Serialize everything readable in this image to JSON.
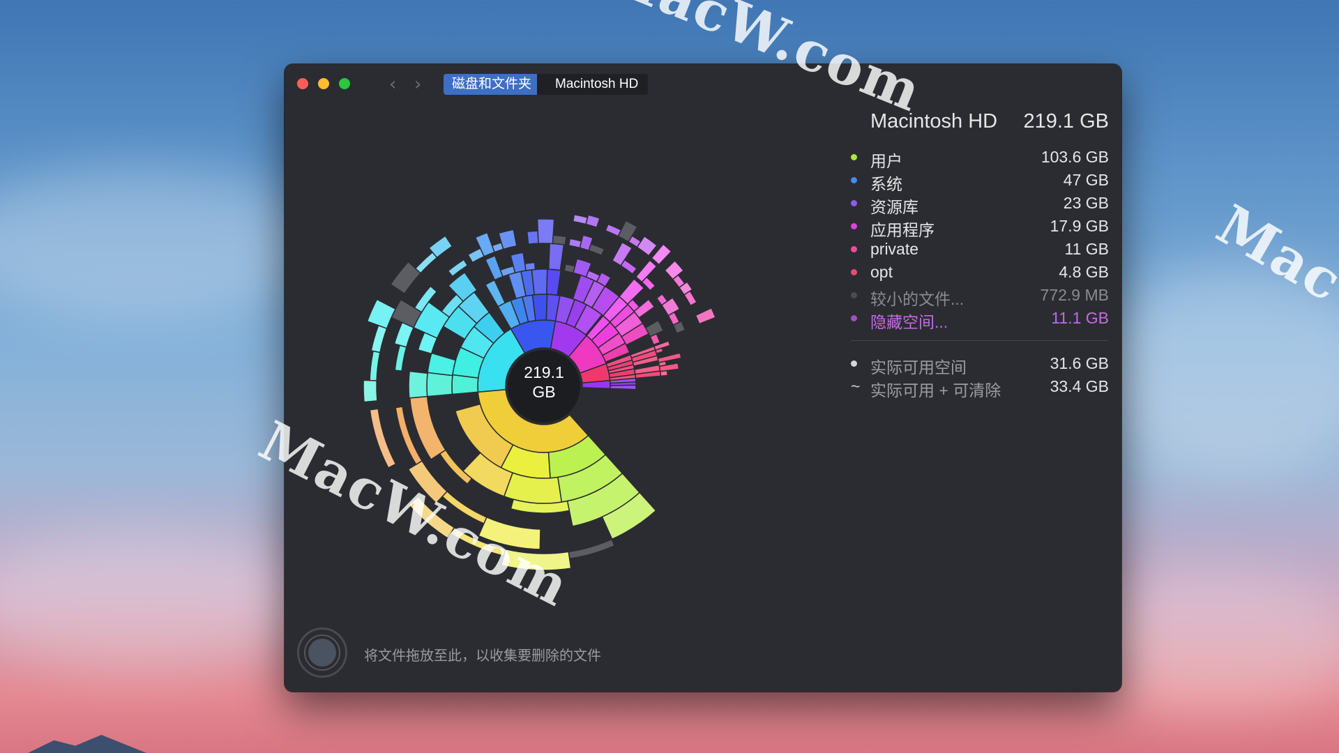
{
  "breadcrumb": {
    "crumb1": "磁盘和文件夹",
    "crumb2": "Macintosh HD"
  },
  "chart_center": {
    "value": "219.1",
    "unit": "GB"
  },
  "summary": {
    "title": "Macintosh HD",
    "total": "219.1 GB"
  },
  "legend": [
    {
      "name": "用户",
      "value": "103.6 GB",
      "color": "#a8e840",
      "text_color": "#e6e6e9"
    },
    {
      "name": "系统",
      "value": "47 GB",
      "color": "#3f8ef0",
      "text_color": "#e6e6e9"
    },
    {
      "name": "资源库",
      "value": "23 GB",
      "color": "#8e5cf2",
      "text_color": "#e6e6e9"
    },
    {
      "name": "应用程序",
      "value": "17.9 GB",
      "color": "#e23fe0",
      "text_color": "#e6e6e9"
    },
    {
      "name": "private",
      "value": "11 GB",
      "color": "#ef4b9e",
      "text_color": "#e6e6e9"
    },
    {
      "name": "opt",
      "value": "4.8 GB",
      "color": "#f14a6a",
      "text_color": "#e6e6e9"
    },
    {
      "name": "较小的文件...",
      "value": "772.9 MB",
      "color": "#4b4c52",
      "text_color": "#8a8b90"
    },
    {
      "name": "隐藏空间...",
      "value": "11.1 GB",
      "color": "#a24fc4",
      "text_color": "#c56ae6"
    }
  ],
  "space": [
    {
      "name": "实际可用空间",
      "value": "31.6 GB",
      "marker": "dot"
    },
    {
      "name": "实际可用 + 可清除",
      "value": "33.4 GB",
      "marker": "~"
    }
  ],
  "drop_hint": "将文件拖放至此，以收集要删除的文件",
  "watermark": "MacW.com"
}
